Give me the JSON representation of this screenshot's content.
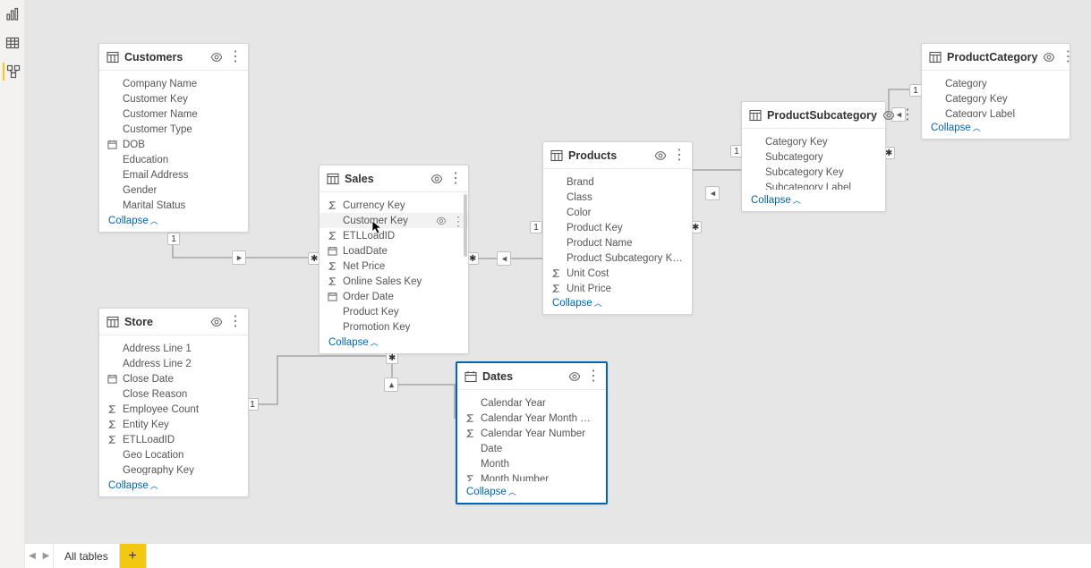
{
  "bottom_tabs": {
    "all_tables": "All tables",
    "add": "+"
  },
  "collapse_label": "Collapse",
  "cardinality": {
    "one": "1",
    "many": "✱"
  },
  "tables": {
    "customers": {
      "title": "Customers",
      "fields": [
        "Company Name",
        "Customer Key",
        "Customer Name",
        "Customer Type",
        "DOB",
        "Education",
        "Email Address",
        "Gender",
        "Marital Status"
      ],
      "icons": [
        "",
        "",
        "",
        "",
        "date",
        "",
        "",
        "",
        ""
      ]
    },
    "sales": {
      "title": "Sales",
      "fields": [
        "Currency Key",
        "Customer Key",
        "ETLLoadID",
        "LoadDate",
        "Net Price",
        "Online Sales Key",
        "Order Date",
        "Product Key",
        "Promotion Key"
      ],
      "icons": [
        "sigma",
        "",
        "sigma",
        "date",
        "sigma",
        "sigma",
        "date",
        "",
        ""
      ],
      "hover_index": 1
    },
    "store": {
      "title": "Store",
      "fields": [
        "Address Line 1",
        "Address Line 2",
        "Close Date",
        "Close Reason",
        "Employee Count",
        "Entity Key",
        "ETLLoadID",
        "Geo Location",
        "Geography Key"
      ],
      "icons": [
        "",
        "",
        "date",
        "",
        "sigma",
        "sigma",
        "sigma",
        "",
        ""
      ]
    },
    "products": {
      "title": "Products",
      "fields": [
        "Brand",
        "Class",
        "Color",
        "Product Key",
        "Product Name",
        "Product Subcategory Key",
        "Unit Cost",
        "Unit Price"
      ],
      "icons": [
        "",
        "",
        "",
        "",
        "",
        "",
        "sigma",
        "sigma"
      ]
    },
    "dates": {
      "title": "Dates",
      "fields": [
        "Calendar Year",
        "Calendar Year Month Number",
        "Calendar Year Number",
        "Date",
        "Month",
        "Month Number"
      ],
      "icons": [
        "",
        "sigma",
        "sigma",
        "",
        "",
        "sigma"
      ]
    },
    "subcat": {
      "title": "ProductSubcategory",
      "fields": [
        "Category Key",
        "Subcategory",
        "Subcategory Key",
        "Subcategory Label"
      ],
      "icons": [
        "",
        "",
        "",
        ""
      ]
    },
    "category": {
      "title": "ProductCategory",
      "fields": [
        "Category",
        "Category Key",
        "Category Label"
      ],
      "icons": [
        "",
        "",
        ""
      ]
    }
  }
}
